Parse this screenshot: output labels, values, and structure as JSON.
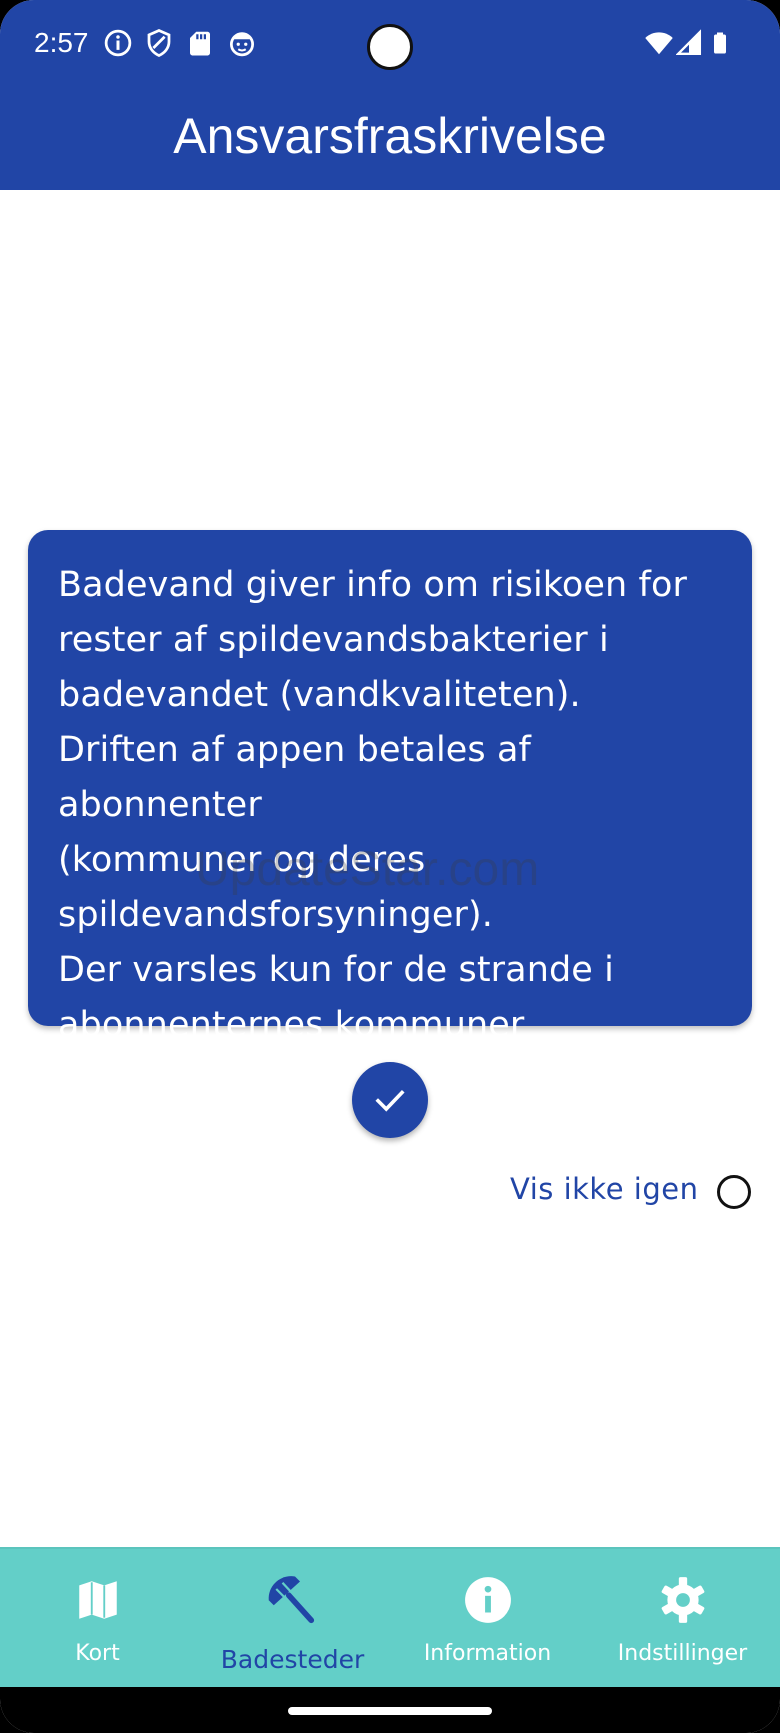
{
  "status_bar": {
    "time": "2:57",
    "icons": [
      "info-icon",
      "shield-icon",
      "sd-card-icon",
      "face-icon",
      "wifi-icon",
      "signal-icon",
      "battery-icon"
    ]
  },
  "app_bar": {
    "title": "Ansvarsfraskrivelse"
  },
  "disclaimer": {
    "text": "Badevand giver info om risikoen for\nrester af spildevandsbakterier i\nbadevandet (vandkvaliteten).\nDriften af appen betales af abonnenter\n(kommuner og deres\nspildevandsforsyninger).\nDer varsles kun for de strande i\nabonnenternes kommuner"
  },
  "watermark": "UpdateStar.com",
  "confirm_icon": "check-icon",
  "dont_show_again": {
    "label": "Vis ikke igen",
    "checked": false
  },
  "bottom_nav": {
    "items": [
      {
        "label": "Kort",
        "icon": "map-icon",
        "active": false
      },
      {
        "label": "Badesteder",
        "icon": "beach-umbrella-icon",
        "active": true
      },
      {
        "label": "Information",
        "icon": "info-icon",
        "active": false
      },
      {
        "label": "Indstillinger",
        "icon": "gear-icon",
        "active": false
      }
    ]
  },
  "colors": {
    "primary": "#2145a6",
    "nav_background": "#63cfc8",
    "background": "#ffffff"
  }
}
